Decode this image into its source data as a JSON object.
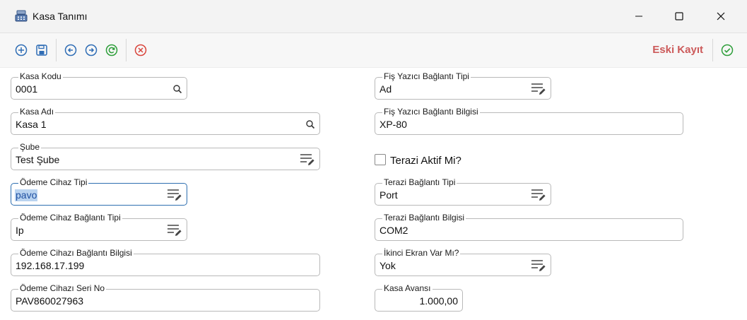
{
  "window": {
    "title": "Kasa Tanımı",
    "controls": [
      "minimize-icon",
      "maximize-icon",
      "close-icon"
    ]
  },
  "toolbar": {
    "icons": [
      "add-circle-icon",
      "save-icon",
      "prev-icon",
      "next-icon",
      "refresh-icon",
      "cancel-icon"
    ],
    "eski_kayit_label": "Eski Kayıt",
    "confirm_icon": "check-circle-icon",
    "accent": "#cc5a5a",
    "icon_blue": "#2f6db5",
    "icon_green": "#2e9e3a",
    "icon_red": "#d9443b"
  },
  "form": {
    "kasa_kodu": {
      "label": "Kasa Kodu",
      "value": "0001",
      "icon": "search-icon"
    },
    "kasa_adi": {
      "label": "Kasa Adı",
      "value": "Kasa 1",
      "icon": "search-icon"
    },
    "sube": {
      "label": "Şube",
      "value": "Test Şube",
      "icon": "list-edit-icon"
    },
    "odeme_cihaz_tipi": {
      "label": "Ödeme Cihaz Tipi",
      "value": "pavo",
      "icon": "list-edit-icon"
    },
    "odeme_cihaz_baglanti_tipi": {
      "label": "Ödeme Cihaz Bağlantı Tipi",
      "value": "Ip",
      "icon": "list-edit-icon"
    },
    "odeme_cihazi_baglanti_bilgisi": {
      "label": "Ödeme Cihazı Bağlantı Bilgisi",
      "value": "192.168.17.199"
    },
    "odeme_cihazi_seri_no": {
      "label": "Ödeme Cihazı Seri No",
      "value": "PAV860027963"
    },
    "fis_yazici_baglanti_tipi": {
      "label": "Fiş Yazıcı Bağlantı Tipi",
      "value": "Ad",
      "icon": "list-edit-icon"
    },
    "fis_yazici_baglanti_bilgisi": {
      "label": "Fiş Yazıcı Bağlantı Bilgisi",
      "value": "XP-80"
    },
    "terazi_aktif": {
      "label": "Terazi Aktif Mi?",
      "checked": false
    },
    "terazi_baglanti_tipi": {
      "label": "Terazi Bağlantı Tipi",
      "value": "Port",
      "icon": "list-edit-icon"
    },
    "terazi_baglanti_bilgisi": {
      "label": "Terazi Bağlantı Bilgisi",
      "value": "COM2"
    },
    "ikinci_ekran": {
      "label": "İkinci Ekran Var Mı?",
      "value": "Yok",
      "icon": "list-edit-icon"
    },
    "kasa_avansi": {
      "label": "Kasa Avansı",
      "value": "1.000,00"
    }
  }
}
